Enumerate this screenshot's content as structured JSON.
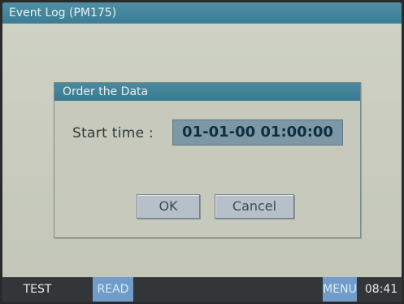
{
  "window": {
    "title": "Event Log (PM175)"
  },
  "dialog": {
    "title": "Order the Data",
    "start_time_label": "Start time :",
    "start_time_value": "01-01-00 01:00:00",
    "ok_label": "OK",
    "cancel_label": "Cancel"
  },
  "statusbar": {
    "test_label": "TEST",
    "read_label": "READ",
    "menu_label": "MENU",
    "clock": "08:41"
  },
  "colors": {
    "titlebar": "#3b7d94",
    "field_value_bg": "#7d97a4",
    "softkey_active": "#6f9cc8"
  }
}
